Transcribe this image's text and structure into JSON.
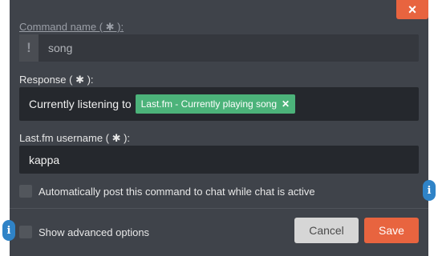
{
  "dialog": {
    "close_icon": "×",
    "command_name": {
      "label": "Command name ( ✱ ):",
      "prefix": "!",
      "value": "song"
    },
    "response": {
      "label": "Response ( ✱ ):",
      "text": "Currently listening to",
      "tag_label": "Last.fm - Currently playing song",
      "tag_remove": "✕"
    },
    "lastfm_username": {
      "label": "Last.fm username ( ✱ ):",
      "value": "kappa"
    },
    "auto_post": {
      "label": "Automatically post this command to chat while chat is active",
      "checked": false
    },
    "advanced": {
      "label": "Show advanced options",
      "checked": false
    },
    "buttons": {
      "cancel": "Cancel",
      "save": "Save"
    },
    "info_icon": "i"
  },
  "colors": {
    "accent": "#e8643f",
    "tag": "#4cb37a",
    "info": "#2f83c7"
  }
}
